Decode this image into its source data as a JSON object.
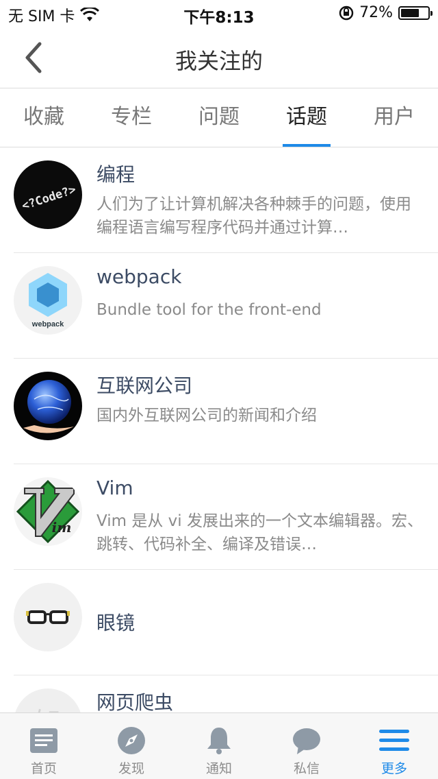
{
  "status_bar": {
    "carrier": "无 SIM 卡",
    "time": "下午8:13",
    "battery_percent": "72%",
    "battery_level": 0.72
  },
  "nav": {
    "title": "我关注的"
  },
  "tabs": [
    {
      "label": "收藏",
      "active": false
    },
    {
      "label": "专栏",
      "active": false
    },
    {
      "label": "问题",
      "active": false
    },
    {
      "label": "话题",
      "active": true
    },
    {
      "label": "用户",
      "active": false
    }
  ],
  "topics": [
    {
      "title": "编程",
      "description": "人们为了让计算机解决各种棘手的问题，使用编程语言编写程序代码并通过计算…",
      "avatar_icon": "code-avatar-icon"
    },
    {
      "title": "webpack",
      "description": "Bundle tool for the front-end",
      "avatar_icon": "webpack-logo-icon",
      "avatar_text": "webpack"
    },
    {
      "title": "互联网公司",
      "description": "国内外互联网公司的新闻和介绍",
      "avatar_icon": "globe-hand-icon"
    },
    {
      "title": "Vim",
      "description": "Vim 是从 vi 发展出来的一个文本编辑器。宏、跳转、代码补全、编译及错误…",
      "avatar_icon": "vim-logo-icon"
    },
    {
      "title": "眼镜",
      "description": "",
      "avatar_icon": "glasses-icon"
    },
    {
      "title": "网页爬虫",
      "description": "",
      "avatar_icon": "topic-placeholder-icon"
    }
  ],
  "tab_bar": [
    {
      "label": "首页",
      "icon": "home-icon",
      "active": false
    },
    {
      "label": "发现",
      "icon": "compass-icon",
      "active": false
    },
    {
      "label": "通知",
      "icon": "bell-icon",
      "active": false
    },
    {
      "label": "私信",
      "icon": "chat-icon",
      "active": false
    },
    {
      "label": "更多",
      "icon": "menu-icon",
      "active": true
    }
  ],
  "colors": {
    "accent": "#1e8ae8",
    "title": "#3c4b64",
    "muted": "#8a8a8a"
  }
}
